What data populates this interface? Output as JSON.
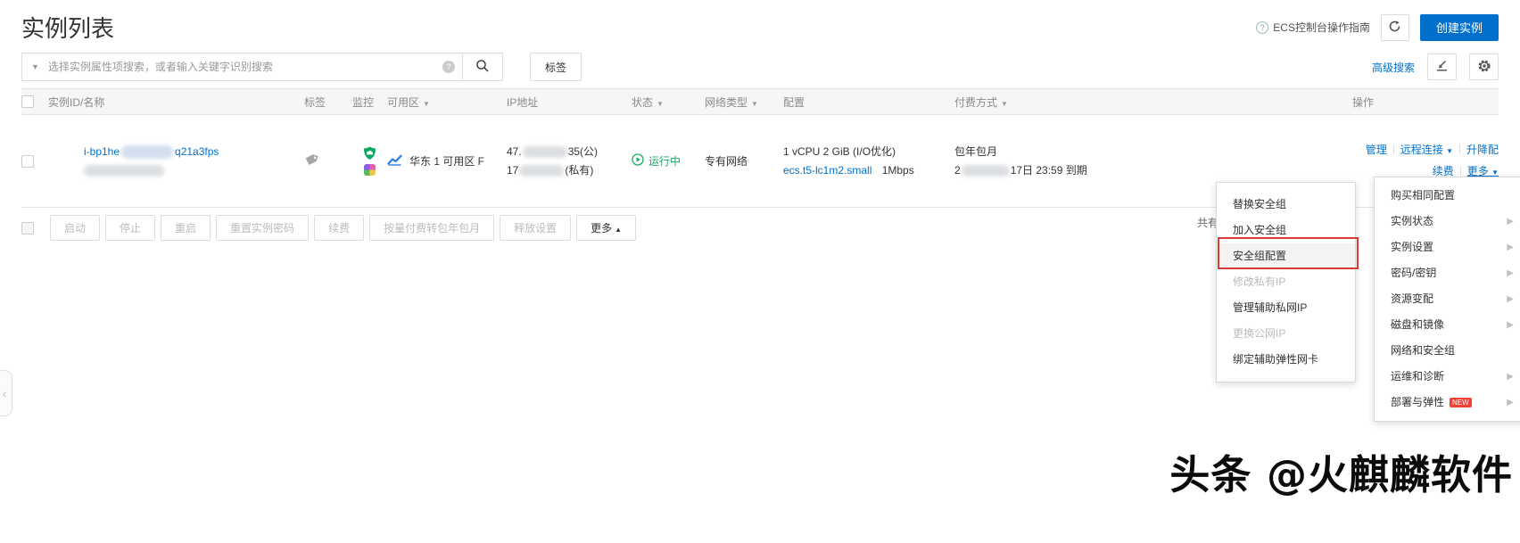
{
  "header": {
    "title": "实例列表",
    "guide_link": "ECS控制台操作指南",
    "create_button": "创建实例"
  },
  "toolbar": {
    "search_placeholder": "选择实例属性项搜索，或者输入关键字识别搜索",
    "tag_button": "标签",
    "advanced_search": "高级搜索"
  },
  "table": {
    "columns": [
      "实例ID/名称",
      "标签",
      "监控",
      "可用区",
      "IP地址",
      "状态",
      "网络类型",
      "配置",
      "付费方式",
      "操作"
    ],
    "row": {
      "id_prefix": "i-bp1he",
      "id_suffix": "q21a3fps",
      "zone": "华东 1 可用区 F",
      "ip_public_prefix": "47.",
      "ip_public_suffix": "35(公)",
      "ip_private_prefix": "17",
      "ip_private_suffix": "(私有)",
      "status": "运行中",
      "network_type": "专有网络",
      "config_line1": "1 vCPU 2 GiB (I/O优化)",
      "instance_type": "ecs.t5-lc1m2.small",
      "bandwidth": "1Mbps",
      "billing_method": "包年包月",
      "expire_prefix": "2",
      "expire_suffix": "17日 23:59 到期",
      "actions": {
        "manage": "管理",
        "remote_connect": "远程连接",
        "upgrade_downgrade": "升降配",
        "renew": "续费",
        "more": "更多"
      }
    }
  },
  "footer": {
    "buttons": [
      "启动",
      "停止",
      "重启",
      "重置实例密码",
      "续费",
      "按量付费转包年包月",
      "释放设置"
    ],
    "more_button": "更多",
    "total_text": "共有"
  },
  "submenu": {
    "items": [
      {
        "label": "替换安全组"
      },
      {
        "label": "加入安全组"
      },
      {
        "label": "安全组配置"
      },
      {
        "label": "修改私有IP"
      },
      {
        "label": "管理辅助私网IP"
      },
      {
        "label": "更换公网IP"
      },
      {
        "label": "绑定辅助弹性网卡"
      }
    ]
  },
  "more_menu": {
    "items": [
      {
        "label": "购买相同配置"
      },
      {
        "label": "实例状态"
      },
      {
        "label": "实例设置"
      },
      {
        "label": "密码/密钥"
      },
      {
        "label": "资源变配"
      },
      {
        "label": "磁盘和镜像"
      },
      {
        "label": "网络和安全组"
      },
      {
        "label": "运维和诊断"
      },
      {
        "label": "部署与弹性",
        "badge": "NEW"
      }
    ]
  },
  "watermark": "头条 @火麒麟软件",
  "icons": {
    "question": "?",
    "caret_down": "▼",
    "caret_up": "▲",
    "sort_caret": "▼",
    "search_caret": "▼",
    "submenu_arrow": "▶"
  },
  "colors": {
    "primary_blue": "#0070cc",
    "status_green": "#1cab62",
    "highlight_red": "#d93a32"
  }
}
